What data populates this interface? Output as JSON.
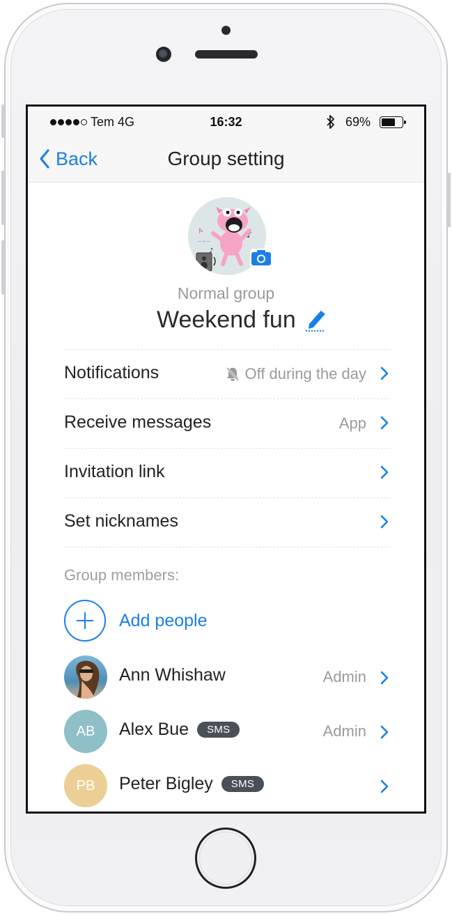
{
  "status_bar": {
    "carrier": "Tem 4G",
    "time": "16:32",
    "battery_percent": "69%",
    "battery_level": 0.69,
    "signal_bars_filled": 4,
    "signal_bars_total": 5
  },
  "nav": {
    "back_label": "Back",
    "title": "Group setting"
  },
  "group": {
    "type": "Normal group",
    "name": "Weekend fun"
  },
  "settings": [
    {
      "label": "Notifications",
      "value": "Off during the day",
      "icon": "bell-off-icon"
    },
    {
      "label": "Receive messages",
      "value": "App"
    },
    {
      "label": "Invitation link",
      "value": ""
    },
    {
      "label": "Set nicknames",
      "value": ""
    }
  ],
  "members_section": {
    "label": "Group members:",
    "add_label": "Add people"
  },
  "members": [
    {
      "name": "Ann Whishaw",
      "initials": "",
      "role": "Admin",
      "sms": "",
      "color": "#6a9bb8"
    },
    {
      "name": "Alex Bue",
      "initials": "AB",
      "role": "Admin",
      "sms": "SMS",
      "color": "#8fbfc7"
    },
    {
      "name": "Peter Bigley",
      "initials": "PB",
      "role": "",
      "sms": "SMS",
      "color": "#eccf95"
    }
  ],
  "colors": {
    "accent": "#1a7fe6",
    "secondary_text": "#9a9a9e",
    "sms_badge": "#4a5058"
  }
}
